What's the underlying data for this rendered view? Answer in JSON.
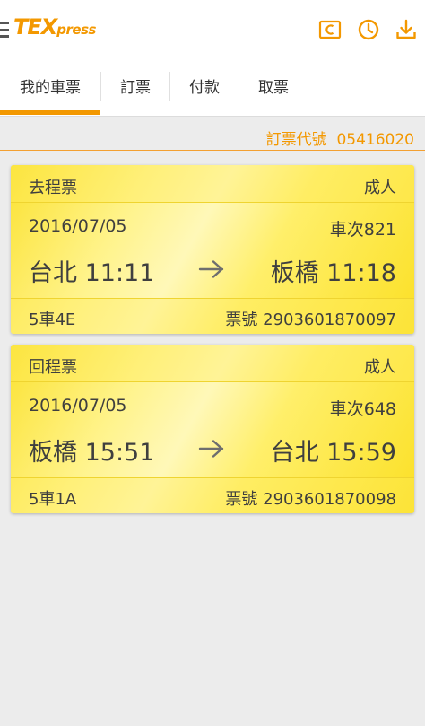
{
  "app": {
    "logo_main": "TEX",
    "logo_sub": "press"
  },
  "header_icons": [
    "calendar-c-icon",
    "clock-icon",
    "download-icon"
  ],
  "tabs": [
    {
      "label": "我的車票",
      "active": true
    },
    {
      "label": "訂票",
      "active": false
    },
    {
      "label": "付款",
      "active": false
    },
    {
      "label": "取票",
      "active": false
    }
  ],
  "order": {
    "label": "訂票代號",
    "code": "05416020"
  },
  "tickets": [
    {
      "type": "去程票",
      "passenger": "成人",
      "date": "2016/07/05",
      "train": "車次821",
      "from": "台北 11:11",
      "to": "板橋 11:18",
      "seat": "5車4E",
      "ticket_no": "票號 2903601870097"
    },
    {
      "type": "回程票",
      "passenger": "成人",
      "date": "2016/07/05",
      "train": "車次648",
      "from": "板橋 15:51",
      "to": "台北 15:59",
      "seat": "5車1A",
      "ticket_no": "票號 2903601870098"
    }
  ],
  "colors": {
    "accent": "#f39800",
    "ticket_yellow": "#fbe233",
    "background": "#ececec"
  }
}
